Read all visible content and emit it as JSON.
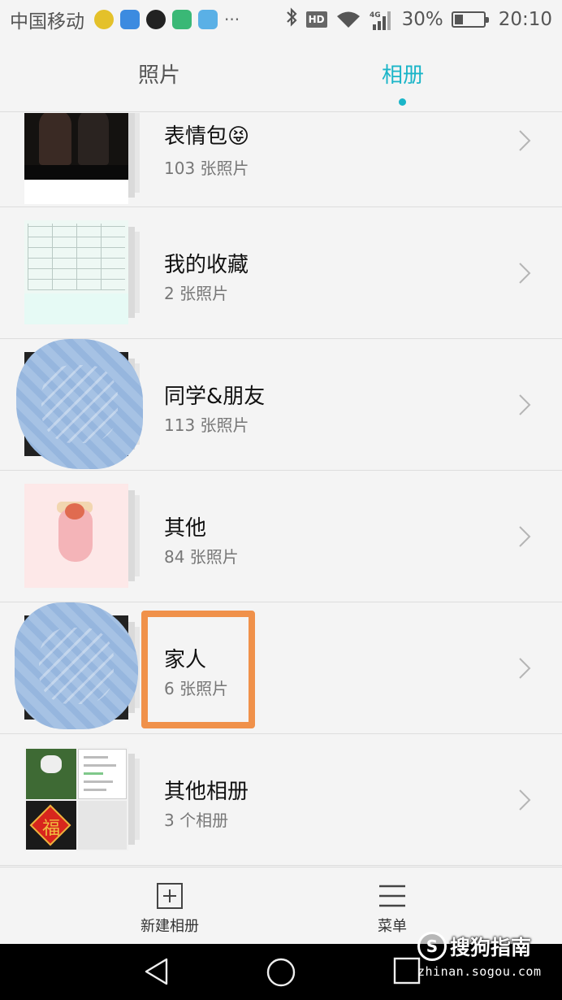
{
  "status_bar": {
    "carrier": "中国移动",
    "more": "···",
    "hd": "HD",
    "network": "4G",
    "battery_percent": "30%",
    "battery_level": 0.3,
    "time": "20:10"
  },
  "tabs": [
    {
      "label": "照片",
      "active": false
    },
    {
      "label": "相册",
      "active": true
    }
  ],
  "albums": [
    {
      "name": "表情包😝",
      "count": "103 张照片"
    },
    {
      "name": "我的收藏",
      "count": "2 张照片"
    },
    {
      "name": "同学&朋友",
      "count": "113 张照片"
    },
    {
      "name": "其他",
      "count": "84 张照片"
    },
    {
      "name": "家人",
      "count": "6 张照片"
    },
    {
      "name": "其他相册",
      "count": "3 个相册"
    }
  ],
  "thumb_text": {
    "fu": "福"
  },
  "actions": {
    "new_album": "新建相册",
    "menu": "菜单"
  },
  "watermark": {
    "logo": "S",
    "text": "搜狗指南",
    "url": "zhinan.sogou.com"
  },
  "colors": {
    "accent": "#1ab5c8",
    "highlight": "#f0914a"
  }
}
